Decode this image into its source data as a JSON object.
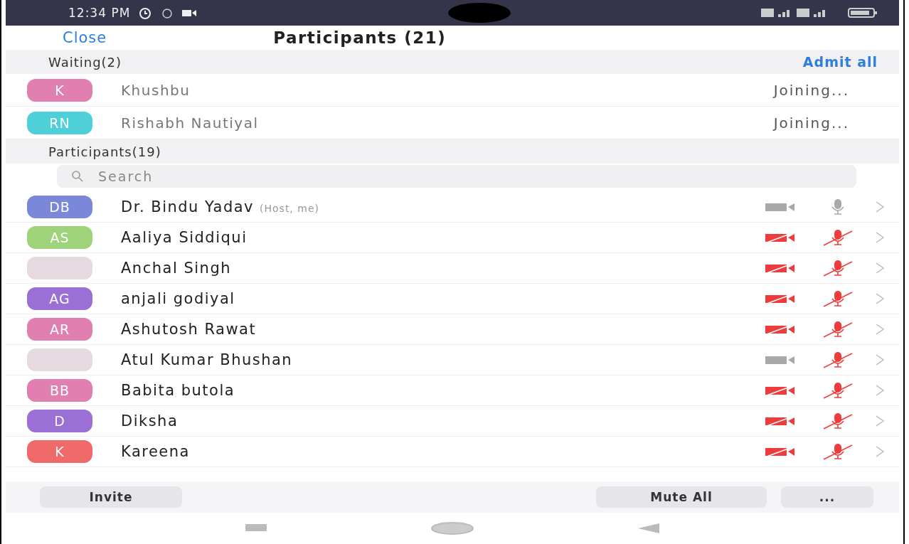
{
  "status_bar": {
    "time": "12:34 PM"
  },
  "header": {
    "close": "Close",
    "title": "Participants (21)"
  },
  "waiting": {
    "title": "Waiting(2)",
    "action": "Admit all",
    "people": [
      {
        "initials": "K",
        "color": "#e07fb0",
        "name": "Khushbu",
        "status": "Joining..."
      },
      {
        "initials": "RN",
        "color": "#4fcfd8",
        "name": "Rishabh Nautiyal",
        "status": "Joining..."
      }
    ]
  },
  "participants": {
    "title": "Participants(19)",
    "search": {
      "placeholder": "Search"
    },
    "people": [
      {
        "kind": "initials",
        "initials": "DB",
        "color": "#7b87d8",
        "name": "Dr. Bindu Yadav",
        "role": "(Host, me)",
        "video_on": true,
        "mic_on": true
      },
      {
        "kind": "initials",
        "initials": "AS",
        "color": "#9ed37a",
        "name": "Aaliya Siddiqui",
        "video_on": false,
        "mic_on": false
      },
      {
        "kind": "photo",
        "name": "Anchal Singh",
        "video_on": false,
        "mic_on": false
      },
      {
        "kind": "initials",
        "initials": "AG",
        "color": "#9a6fd6",
        "name": "anjali godiyal",
        "video_on": false,
        "mic_on": false
      },
      {
        "kind": "initials",
        "initials": "AR",
        "color": "#e07fb0",
        "name": "Ashutosh Rawat",
        "video_on": false,
        "mic_on": false
      },
      {
        "kind": "photo",
        "name": "Atul Kumar Bhushan",
        "video_on": true,
        "mic_on": false
      },
      {
        "kind": "initials",
        "initials": "BB",
        "color": "#e07fb0",
        "name": "Babita butola",
        "video_on": false,
        "mic_on": false
      },
      {
        "kind": "initials",
        "initials": "D",
        "color": "#9a6fd6",
        "name": "Diksha",
        "video_on": false,
        "mic_on": false
      },
      {
        "kind": "initials",
        "initials": "K",
        "color": "#f06a6a",
        "name": "Kareena",
        "video_on": false,
        "mic_on": false
      }
    ]
  },
  "footer": {
    "invite": "Invite",
    "mute_all": "Mute All",
    "more": "..."
  }
}
